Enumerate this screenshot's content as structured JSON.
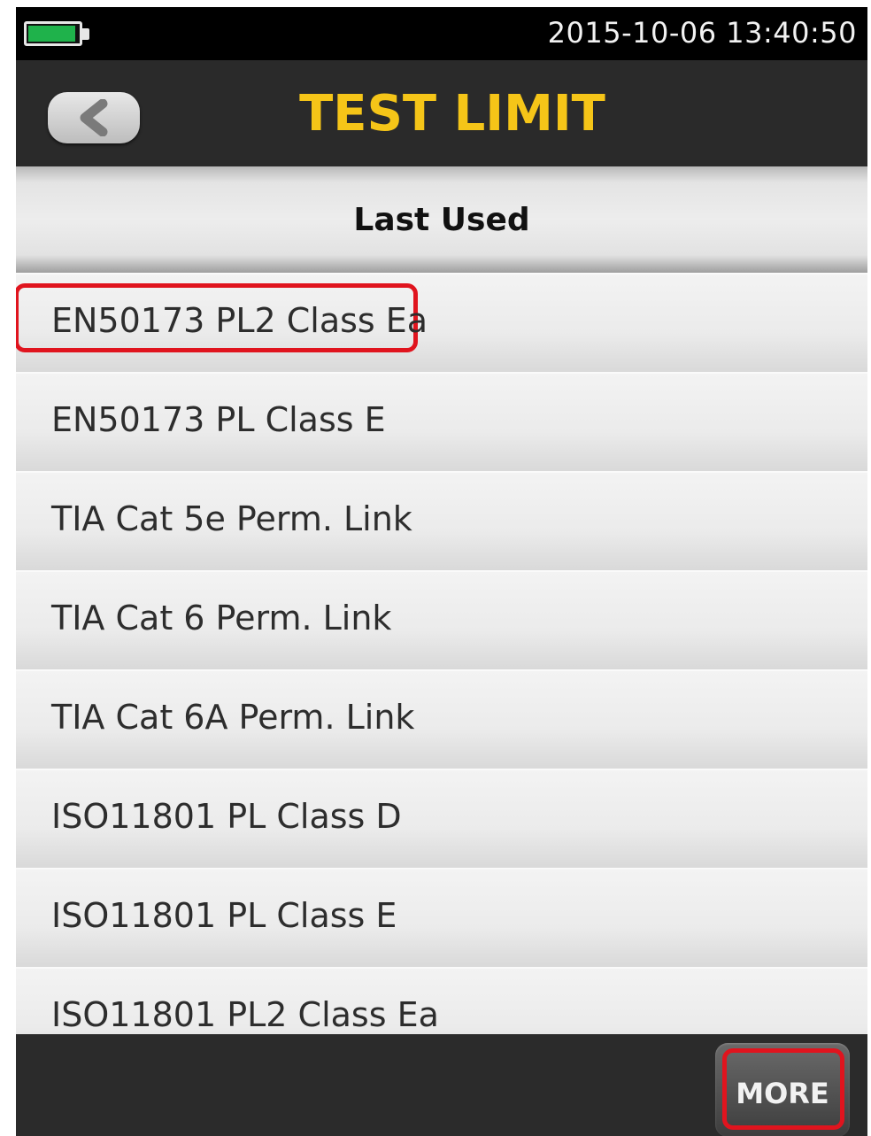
{
  "status_bar": {
    "datetime": "2015-10-06 13:40:50",
    "battery_level": 0.95,
    "battery_color": "#1fb24b"
  },
  "header": {
    "title": "TEST LIMIT",
    "title_color": "#f5c518",
    "back_icon": "chevron-left-icon"
  },
  "section": {
    "label": "Last Used"
  },
  "list": {
    "items": [
      {
        "label": "EN50173 PL2 Class Ea"
      },
      {
        "label": "EN50173 PL Class E"
      },
      {
        "label": "TIA Cat 5e Perm. Link"
      },
      {
        "label": "TIA Cat 6 Perm. Link"
      },
      {
        "label": "TIA Cat 6A Perm. Link"
      },
      {
        "label": "ISO11801 PL Class D"
      },
      {
        "label": "ISO11801 PL Class E"
      },
      {
        "label": "ISO11801 PL2 Class Ea"
      }
    ],
    "highlighted_index": 0,
    "highlight_color": "#e0141e"
  },
  "footer": {
    "more_label": "MORE"
  }
}
